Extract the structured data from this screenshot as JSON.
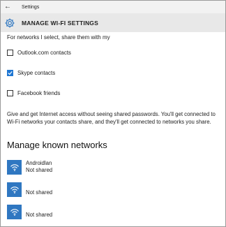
{
  "window": {
    "back_glyph": "←",
    "title": "Settings"
  },
  "header": {
    "icon": "gear-icon",
    "title": "MANAGE WI-FI SETTINGS"
  },
  "share_section": {
    "intro": "For networks I select, share them with my",
    "options": [
      {
        "label": "Outlook.com contacts",
        "checked": false
      },
      {
        "label": "Skype contacts",
        "checked": true
      },
      {
        "label": "Facebook friends",
        "checked": false
      }
    ],
    "description": "Give and get Internet access without seeing shared passwords. You'll get connected to Wi-Fi networks your contacts share, and they'll get connected to networks you share."
  },
  "known_networks": {
    "title": "Manage known networks",
    "items": [
      {
        "name": "Androidlan",
        "status": "Not shared",
        "icon": "wifi-icon"
      },
      {
        "name": "",
        "status": "Not shared",
        "icon": "wifi-icon"
      },
      {
        "name": "",
        "status": "Not shared",
        "icon": "wifi-icon"
      }
    ]
  },
  "colors": {
    "accent": "#1e76d2",
    "wifi_tile": "#2f77c1",
    "header_bg": "#e8e8e8",
    "titlebar_bg": "#f2f2f2"
  }
}
